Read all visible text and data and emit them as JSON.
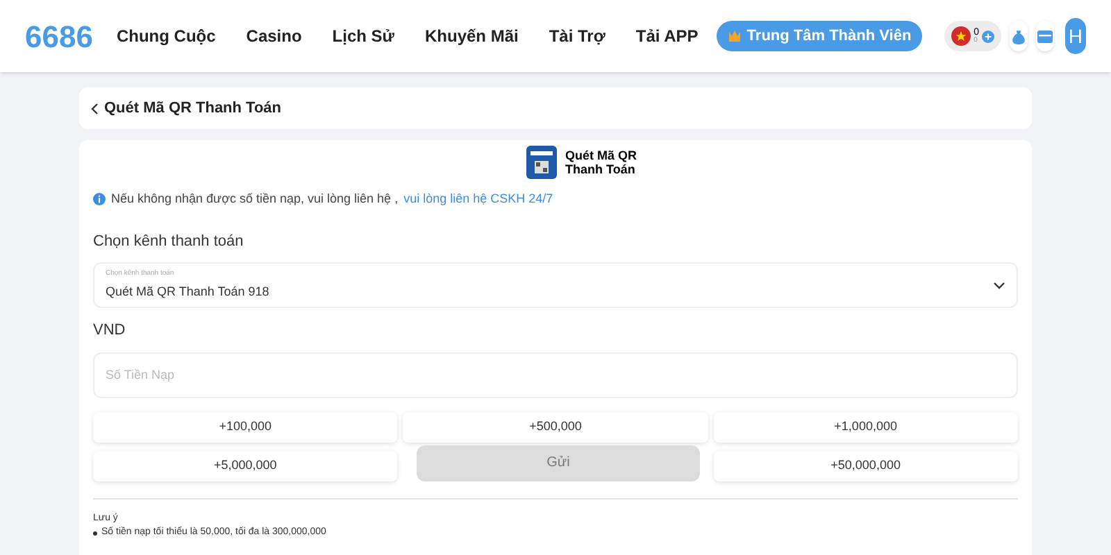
{
  "header": {
    "logo": "6686",
    "nav": [
      {
        "label": "Chung Cuộc"
      },
      {
        "label": "Casino"
      },
      {
        "label": "Lịch Sử"
      },
      {
        "label": "Khuyến Mãi"
      },
      {
        "label": "Tài Trợ"
      },
      {
        "label": "Tải APP"
      }
    ],
    "member_button": "Trung Tâm Thành Viên",
    "balance": "0",
    "coins": "0",
    "avatar": "H"
  },
  "back_bar": {
    "title": "Quét Mã QR Thanh Toán"
  },
  "method": {
    "title": "Quét Mã QR Thanh Toán"
  },
  "notice": {
    "text": "Nếu không nhận được số tiền nạp, vui lòng liên hệ ,",
    "link": "vui lòng liên hệ CSKH 24/7"
  },
  "channel": {
    "heading": "Chọn kênh thanh toán",
    "label": "Chọn kênh thanh toán",
    "value": "Quét Mã QR Thanh Toán 918"
  },
  "currency": "VND",
  "amount": {
    "placeholder": "Số Tiền Nạp"
  },
  "quick_amounts": [
    {
      "label": "+100,000"
    },
    {
      "label": "+500,000"
    },
    {
      "label": "+1,000,000"
    },
    {
      "label": "+5,000,000"
    },
    {
      "label": "+50,000,000"
    }
  ],
  "submit": {
    "label": "Gửi",
    "disabled": true
  },
  "notes": {
    "title": "Lưu ý",
    "items": [
      "Số tiền nạp tối thiểu là 50,000, tối đa là 300,000,000"
    ]
  }
}
